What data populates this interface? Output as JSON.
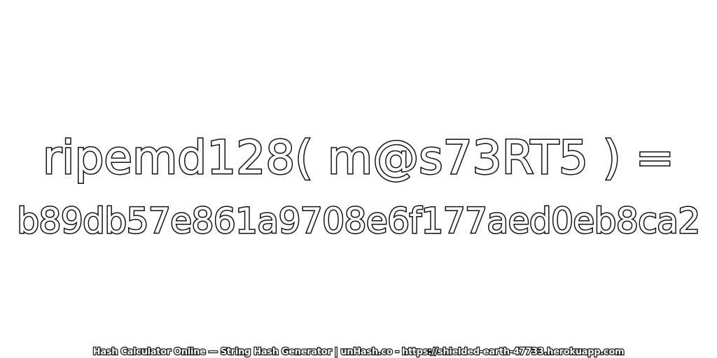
{
  "expression": "ripemd128( m@s73RT5 ) =",
  "hash": "b89db57e861a9708e6f177aed0eb8ca2",
  "footer": "Hash Calculator Online — String Hash Generator | unHash.co - https://shielded-earth-47733.herokuapp.com",
  "colors": {
    "background": "#ffffff",
    "text_fill": "#ffffff",
    "text_stroke": "#111111"
  }
}
